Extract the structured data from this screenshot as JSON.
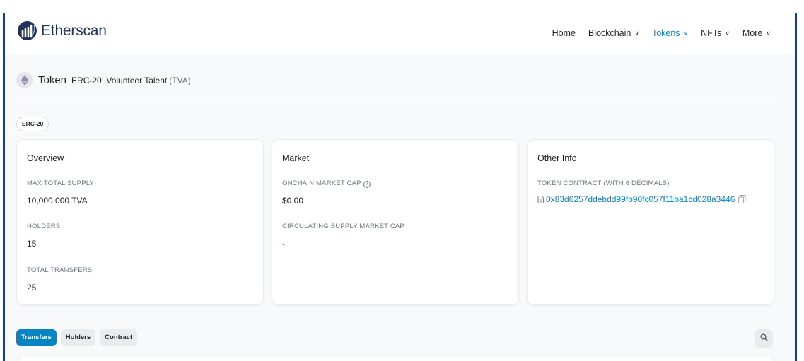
{
  "brand": {
    "name": "Etherscan"
  },
  "nav": {
    "items": [
      {
        "label": "Home",
        "dropdown": false,
        "active": false
      },
      {
        "label": "Blockchain",
        "dropdown": true,
        "active": false
      },
      {
        "label": "Tokens",
        "dropdown": true,
        "active": true
      },
      {
        "label": "NFTs",
        "dropdown": true,
        "active": false
      },
      {
        "label": "More",
        "dropdown": true,
        "active": false
      }
    ],
    "chevron": "∨"
  },
  "token": {
    "word": "Token",
    "name": "ERC-20: Volunteer Talent",
    "symbol": "(TVA)",
    "badge": "ERC-20"
  },
  "overview": {
    "title": "Overview",
    "max_supply_label": "MAX TOTAL SUPPLY",
    "max_supply_value": "10,000,000 TVA",
    "holders_label": "HOLDERS",
    "holders_value": "15",
    "transfers_label": "TOTAL TRANSFERS",
    "transfers_value": "25"
  },
  "market": {
    "title": "Market",
    "onchain_cap_label": "ONCHAIN MARKET CAP",
    "onchain_cap_value": "$0.00",
    "circ_cap_label": "CIRCULATING SUPPLY MARKET CAP",
    "circ_cap_value": "-"
  },
  "other_info": {
    "title": "Other Info",
    "contract_label": "TOKEN CONTRACT (WITH 6 DECIMALS)",
    "contract_address": "0x83d6257ddebdd99fb90fc057f11ba1cd028a3446"
  },
  "tabs": [
    "Transfers",
    "Holders",
    "Contract"
  ],
  "colors": {
    "accent": "#0784c3",
    "brand": "#21325b"
  },
  "icons": {
    "search": "search-icon",
    "copy": "copy-icon",
    "document": "document-icon"
  }
}
